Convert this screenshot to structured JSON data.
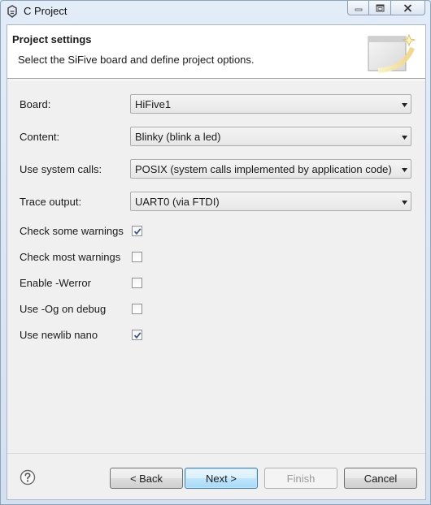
{
  "window": {
    "title": "C Project",
    "controls": [
      "minimize-icon",
      "maximize-icon",
      "close-icon"
    ]
  },
  "header": {
    "title": "Project settings",
    "description": "Select the SiFive board and define project options."
  },
  "fields": {
    "board": {
      "label": "Board:",
      "value": "HiFive1"
    },
    "content": {
      "label": "Content:",
      "value": "Blinky (blink a led)"
    },
    "syscalls": {
      "label": "Use system calls:",
      "value": "POSIX (system calls implemented by application code)"
    },
    "trace": {
      "label": "Trace output:",
      "value": "UART0 (via FTDI)"
    }
  },
  "options": {
    "some_warnings": {
      "label": "Check some warnings",
      "checked": true
    },
    "most_warnings": {
      "label": "Check most warnings",
      "checked": false
    },
    "werror": {
      "label": "Enable -Werror",
      "checked": false
    },
    "og_debug": {
      "label": "Use -Og on debug",
      "checked": false
    },
    "newlib_nano": {
      "label": "Use newlib nano",
      "checked": true
    }
  },
  "buttons": {
    "back": "< Back",
    "next": "Next >",
    "finish": "Finish",
    "cancel": "Cancel"
  },
  "colors": {
    "accent_default_button": "#3c7fb1",
    "check_mark": "#3a5a8c"
  }
}
